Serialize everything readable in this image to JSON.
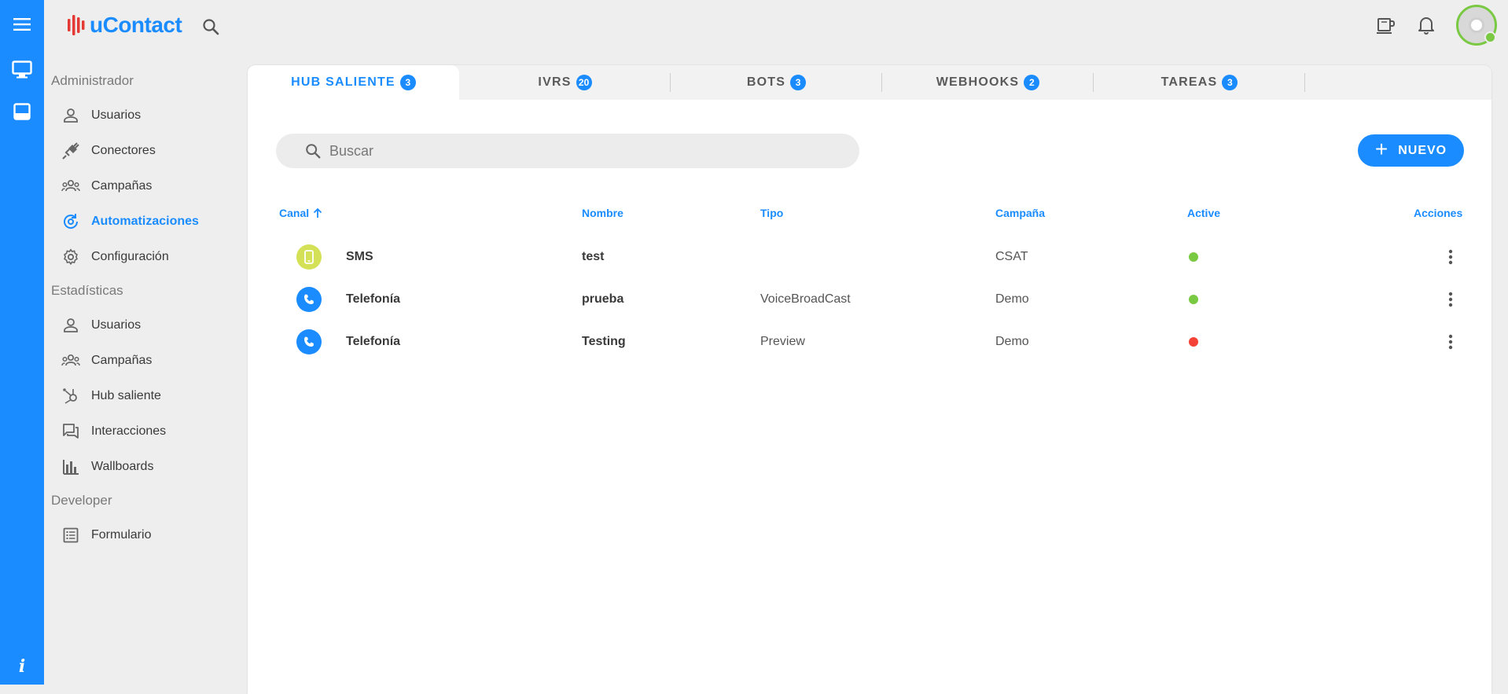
{
  "app": {
    "brand": "uContact",
    "accent": "#1a8cff"
  },
  "icons": {
    "menu": "hamburger-icon",
    "monitor": "monitor-icon",
    "inbox": "inbox-icon",
    "info": "info-icon",
    "search": "search-icon",
    "coffee": "coffee-cup-icon",
    "bell": "bell-icon",
    "avatar": "user-avatar",
    "add": "plus-icon",
    "more": "more-vertical-icon"
  },
  "rail": {
    "info": "i"
  },
  "sidebar": {
    "sections": [
      {
        "title": "Administrador",
        "items": [
          {
            "label": "Usuarios",
            "icon": "person-icon"
          },
          {
            "label": "Conectores",
            "icon": "plug-icon"
          },
          {
            "label": "Campañas",
            "icon": "group-icon"
          },
          {
            "label": "Automatizaciones",
            "icon": "automation-icon",
            "active": true
          },
          {
            "label": "Configuración",
            "icon": "gear-icon"
          }
        ]
      },
      {
        "title": "Estadísticas",
        "items": [
          {
            "label": "Usuarios",
            "icon": "person-icon"
          },
          {
            "label": "Campañas",
            "icon": "group-icon"
          },
          {
            "label": "Hub saliente",
            "icon": "hub-icon"
          },
          {
            "label": "Interacciones",
            "icon": "chat-icon"
          },
          {
            "label": "Wallboards",
            "icon": "bar-chart-icon"
          }
        ]
      },
      {
        "title": "Developer",
        "items": [
          {
            "label": "Formulario",
            "icon": "form-icon"
          }
        ]
      }
    ]
  },
  "tabs": [
    {
      "label": "HUB SALIENTE",
      "count": "3",
      "active": true
    },
    {
      "label": "IVRS",
      "count": "20"
    },
    {
      "label": "BOTS",
      "count": "3"
    },
    {
      "label": "WEBHOOKS",
      "count": "2"
    },
    {
      "label": "TAREAS",
      "count": "3"
    }
  ],
  "search": {
    "placeholder": "Buscar",
    "value": ""
  },
  "new_button": {
    "label": "NUEVO"
  },
  "table": {
    "headers": {
      "canal": "Canal",
      "nombre": "Nombre",
      "tipo": "Tipo",
      "campana": "Campaña",
      "active": "Active",
      "acciones": "Acciones"
    },
    "sort": {
      "column": "canal",
      "direction": "asc"
    },
    "rows": [
      {
        "canal": "SMS",
        "channel_icon": "phone-sms-icon",
        "icon_color": "#d4e157",
        "nombre": "test",
        "tipo": "",
        "campana": "CSAT",
        "active": true,
        "status_color": "#7ac943"
      },
      {
        "canal": "Telefonía",
        "channel_icon": "phone-call-icon",
        "icon_color": "#1a8cff",
        "nombre": "prueba",
        "tipo": "VoiceBroadCast",
        "campana": "Demo",
        "active": true,
        "status_color": "#7ac943"
      },
      {
        "canal": "Telefonía",
        "channel_icon": "phone-call-icon",
        "icon_color": "#1a8cff",
        "nombre": "Testing",
        "tipo": "Preview",
        "campana": "Demo",
        "active": false,
        "status_color": "#f44336"
      }
    ]
  }
}
